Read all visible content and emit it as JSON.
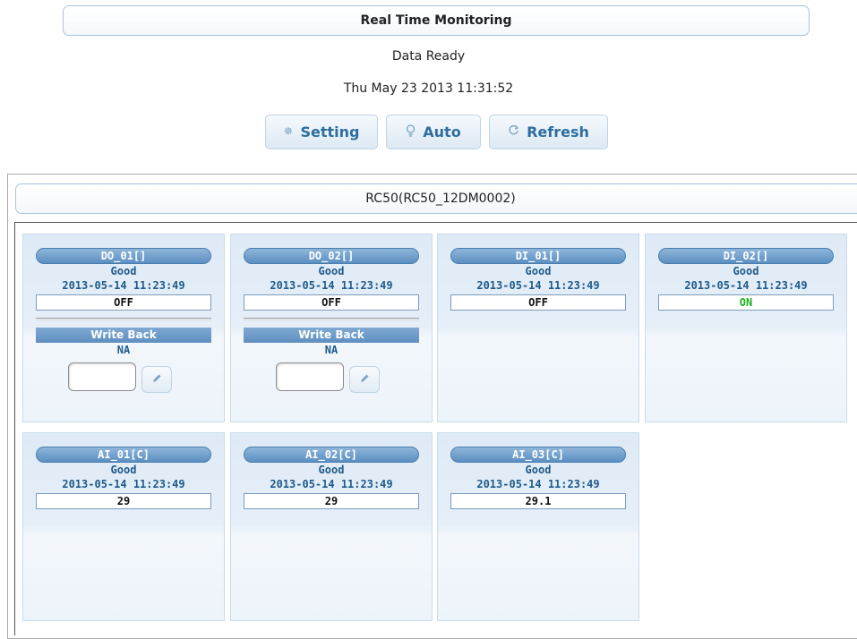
{
  "header": {
    "title": "Real Time Monitoring",
    "status": "Data Ready",
    "datetime": "Thu May 23 2013 11:31:52"
  },
  "toolbar": {
    "setting_label": "Setting",
    "auto_label": "Auto",
    "refresh_label": "Refresh"
  },
  "icons": {
    "setting": "gear-icon",
    "auto": "bulb-icon",
    "refresh": "refresh-icon",
    "write": "pencil-icon"
  },
  "device": {
    "name": "RC50(RC50_12DM0002)"
  },
  "colors": {
    "accent": "#2e6e9e",
    "on_value": "#1bb31b",
    "pill": "#5b8fc1"
  },
  "points": [
    {
      "name": "DO_01[]",
      "quality": "Good",
      "timestamp": "2013-05-14 11:23:49",
      "value": "OFF",
      "write_label": "Write Back",
      "write_status": "NA",
      "write_value": ""
    },
    {
      "name": "DO_02[]",
      "quality": "Good",
      "timestamp": "2013-05-14 11:23:49",
      "value": "OFF",
      "write_label": "Write Back",
      "write_status": "NA",
      "write_value": ""
    },
    {
      "name": "DI_01[]",
      "quality": "Good",
      "timestamp": "2013-05-14 11:23:49",
      "value": "OFF"
    },
    {
      "name": "DI_02[]",
      "quality": "Good",
      "timestamp": "2013-05-14 11:23:49",
      "value": "ON"
    },
    {
      "name": "AI_01[C]",
      "quality": "Good",
      "timestamp": "2013-05-14 11:23:49",
      "value": "29"
    },
    {
      "name": "AI_02[C]",
      "quality": "Good",
      "timestamp": "2013-05-14 11:23:49",
      "value": "29"
    },
    {
      "name": "AI_03[C]",
      "quality": "Good",
      "timestamp": "2013-05-14 11:23:49",
      "value": "29.1"
    }
  ]
}
